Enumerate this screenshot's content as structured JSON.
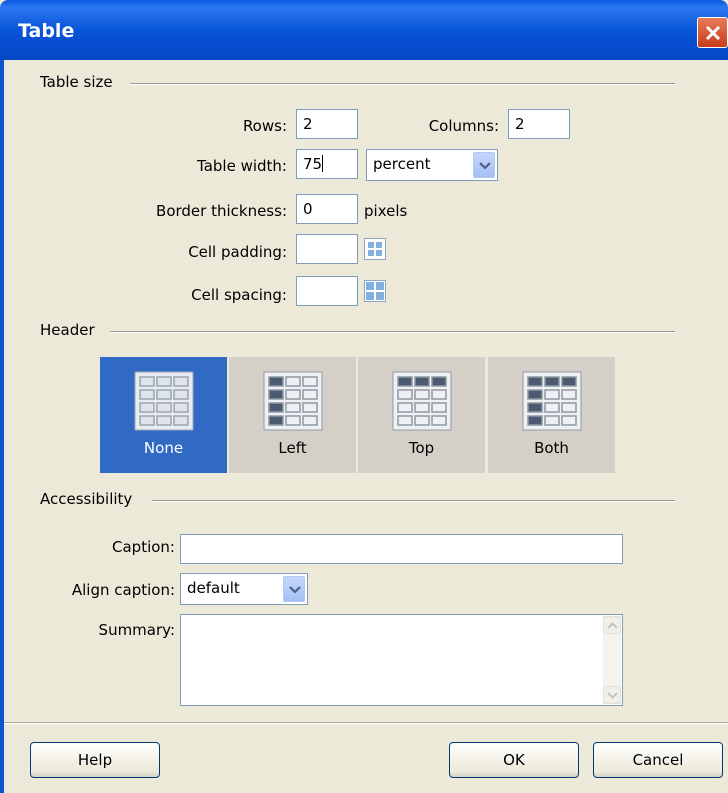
{
  "window": {
    "title": "Table"
  },
  "table_size": {
    "section_label": "Table size",
    "rows_label": "Rows:",
    "rows_value": "2",
    "columns_label": "Columns:",
    "columns_value": "2",
    "width_label": "Table width:",
    "width_value": "75",
    "width_unit": "percent",
    "border_label": "Border thickness:",
    "border_value": "0",
    "border_unit": "pixels",
    "padding_label": "Cell padding:",
    "padding_value": "",
    "spacing_label": "Cell spacing:",
    "spacing_value": ""
  },
  "header": {
    "section_label": "Header",
    "options": [
      {
        "label": "None",
        "selected": true
      },
      {
        "label": "Left",
        "selected": false
      },
      {
        "label": "Top",
        "selected": false
      },
      {
        "label": "Both",
        "selected": false
      }
    ]
  },
  "accessibility": {
    "section_label": "Accessibility",
    "caption_label": "Caption:",
    "caption_value": "",
    "align_label": "Align caption:",
    "align_value": "default",
    "summary_label": "Summary:",
    "summary_value": ""
  },
  "buttons": {
    "help": "Help",
    "ok": "OK",
    "cancel": "Cancel"
  },
  "colors": {
    "title_bar": "#0854d8",
    "selected_header": "#316ac5",
    "dialog_bg": "#ece9d8"
  },
  "icons": {
    "close": "close-icon",
    "dropdown": "chevron-down-icon",
    "cell_padding": "cell-padding-icon",
    "cell_spacing": "cell-spacing-icon"
  }
}
